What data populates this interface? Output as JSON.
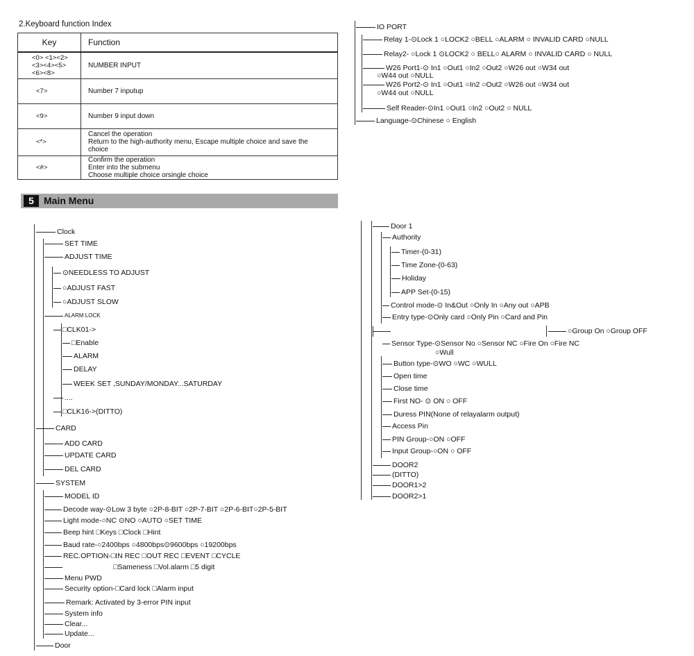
{
  "keyboard": {
    "title": "2.Keyboard function Index",
    "headers": {
      "key": "Key",
      "function": "Function"
    },
    "rows": [
      {
        "key": [
          "<0> <1><2>",
          "<3><4><5>",
          "<6><8>"
        ],
        "function": [
          "NUMBER INPUT"
        ]
      },
      {
        "key": [
          "<7>"
        ],
        "function": [
          "Number 7 inputup"
        ]
      },
      {
        "key": [
          "<9>"
        ],
        "function": [
          "Number 9 input down"
        ]
      },
      {
        "key": [
          "<*>"
        ],
        "function": [
          "Cancel the operation",
          "Return to the high-authority menu, Escape multiple choice and save the",
          "choice"
        ]
      },
      {
        "key": [
          "<#>"
        ],
        "function": [
          "Confirm the operation",
          "Enter into the submenu",
          "Choose multiple choice orsingle choice"
        ]
      }
    ]
  },
  "section": {
    "number": "5",
    "title": "Main Menu"
  },
  "io_tree": [
    "IO PORT",
    "Relay 1-⊙Lock 1   ○LOCK2   ○BELL ○ALARM  ○ INVALID CARD   ○NULL",
    "Relay2- ○Lock 1   ⊙LOCK2   ○ BELL○ ALARM  ○  INVALID CARD  ○ NULL",
    "W26 Port1-⊙ In1 ○Out1   ○In2     ○Out2     ○W26 out       ○W34 out",
    "○W44 out    ○NULL",
    "W26 Port2-⊙ In1 ○Out1   ○In2     ○Out2     ○W26 out       ○W34 out",
    "○W44 out    ○NULL",
    "Self Reader-⊙In1 ○Out1   ○In2      ○Out2      ○ NULL",
    "Language-⊙Chinese         ○ English"
  ],
  "menu_tree": [
    "Clock",
    "SET TIME",
    "ADJUST TIME",
    "⊙NEEDLESS TO ADJUST",
    "○ADJUST FAST",
    "○ADJUST SLOW",
    "ALARM LOCK",
    "□CLK01->",
    "□Enable",
    "ALARM",
    "DELAY",
    "WEEK SET ,SUNDAY/MONDAY...SATURDAY",
    "....",
    "□CLK16->(DITTO)",
    "CARD",
    "ADD CARD",
    "UPDATE  CARD",
    "DEL  CARD",
    "SYSTEM",
    "MODEL ID",
    "Decode way-⊙Low 3 byte ○2P-8-BIT ○2P-7-BIT ○2P-6-BIT○2P-5-BIT",
    "Light mode-○NC ⊙NO ○AUTO ○SET TIME",
    "Beep hint □Keys □Clock □Hint",
    "Baud rate-○2400bps ○4800bps⊙9600bps ○19200bps",
    "REC.OPTION-□IN REC  □OUT REC  □EVENT        □CYCLE",
    "□Sameness  □Vol.alarm  □5 digit",
    "Menu PWD",
    "Security option-□Card lock   □Alarm input",
    "Remark: Activated by 3-error PIN input",
    "System info",
    "Clear...",
    "Update...",
    "Door"
  ],
  "door_tree": [
    "Door 1",
    "Authority",
    "Timer-(0-31)",
    "Time Zone-(0-63)",
    "Holiday",
    "APP Set-(0-15)",
    "Control mode-⊙ In&Out  ○Only In  ○Any out  ○APB",
    "Entry type-⊙Only card   ○Only Pin   ○Card and Pin",
    "○Group On  ○Group OFF",
    "Sensor Type-⊙Sensor No   ○Sensor NC   ○Fire On  ○Fire NC",
    "○Wull",
    "Button type-⊙WO     ○WC  ○WULL",
    "Open time",
    "Close time",
    "First NO- ⊙  ON      ○  OFF",
    "Duress PIN(None of relayalarm output)",
    "Access Pin",
    "PIN Group-○ON        ○OFF",
    "Input Group-○ON      ○  OFF",
    "DOOR2",
    "(DITTO)",
    "DOOR1>2",
    "DOOR2>1"
  ]
}
